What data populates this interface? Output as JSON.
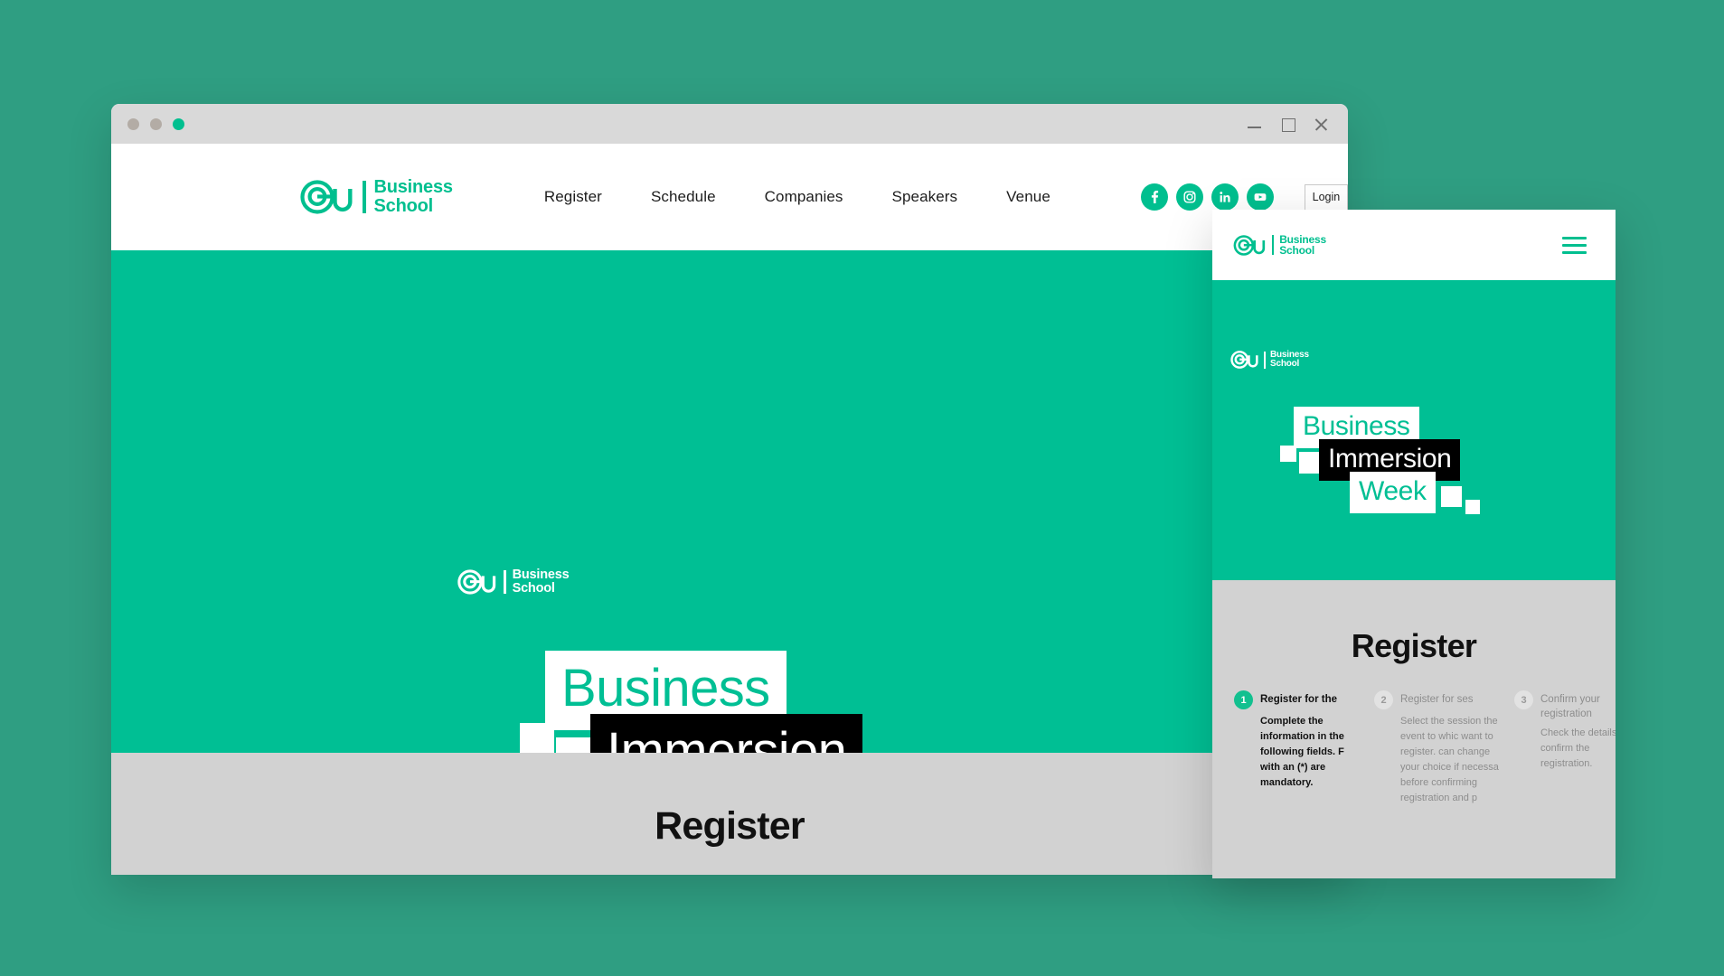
{
  "theme": {
    "page_background": "#2f9e82",
    "hero_green": "#00bf94",
    "brand_green": "#00bf8f",
    "band_gray": "#d2d2d2",
    "titlebar_gray": "#d9d9d9",
    "black": "#000000",
    "white": "#ffffff"
  },
  "window": {
    "dots": [
      {
        "name": "traffic-light-1",
        "color": "#b3aca5"
      },
      {
        "name": "traffic-light-2",
        "color": "#b3aca5"
      },
      {
        "name": "traffic-light-3",
        "color": "#00bf8f"
      }
    ],
    "controls": [
      {
        "name": "minimize",
        "glyph": "minimize-icon"
      },
      {
        "name": "maximize",
        "glyph": "maximize-icon"
      },
      {
        "name": "close",
        "glyph": "close-icon"
      }
    ]
  },
  "brand": {
    "mark": "eu-monogram-icon",
    "line1": "Business",
    "line2": "School"
  },
  "nav": {
    "links": [
      {
        "label": "Register"
      },
      {
        "label": "Schedule"
      },
      {
        "label": "Companies"
      },
      {
        "label": "Speakers"
      },
      {
        "label": "Venue"
      }
    ],
    "social": [
      {
        "name": "facebook-icon",
        "label": "Facebook"
      },
      {
        "name": "instagram-icon",
        "label": "Instagram"
      },
      {
        "name": "linkedin-icon",
        "label": "LinkedIn"
      },
      {
        "name": "youtube-icon",
        "label": "YouTube"
      }
    ],
    "login_label": "Login"
  },
  "hero": {
    "title_line1": "Business",
    "title_line2": "Immersion",
    "title_line3": "Week"
  },
  "register": {
    "heading": "Register"
  },
  "mobile": {
    "menu_icon": "hamburger-menu-icon",
    "register_heading": "Register",
    "steps": [
      {
        "number": "1",
        "title": "Register for the",
        "body": "Complete the information in the following fields. F with an (*) are mandatory.",
        "state": "active"
      },
      {
        "number": "2",
        "title": "Register for ses",
        "body": "Select the session the event to whic want to register. can change your choice if necessa before confirming registration and p",
        "state": "idle"
      },
      {
        "number": "3",
        "title": "Confirm your registration",
        "body": "Check the details and confirm the registration.",
        "state": "idle"
      }
    ]
  }
}
